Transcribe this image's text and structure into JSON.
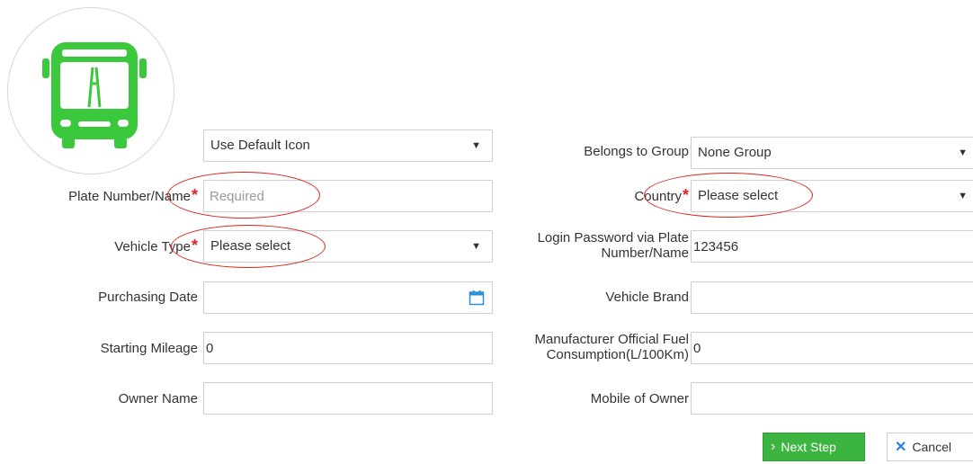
{
  "avatar": {
    "icon": "bus-icon",
    "color": "#3cc83c"
  },
  "icon_select": {
    "value": "Use Default Icon"
  },
  "left": {
    "plate": {
      "label": "Plate Number/Name",
      "required_mark": "*",
      "placeholder": "Required"
    },
    "vehicle_type": {
      "label": "Vehicle Type",
      "required_mark": "*",
      "value": "Please select"
    },
    "purchasing_date": {
      "label": "Purchasing Date",
      "value": ""
    },
    "starting_mileage": {
      "label": "Starting Mileage",
      "value": "0"
    },
    "owner_name": {
      "label": "Owner Name",
      "value": ""
    }
  },
  "right": {
    "group": {
      "label": "Belongs to Group",
      "value": "None Group"
    },
    "country": {
      "label": "Country",
      "required_mark": "*",
      "value": "Please select"
    },
    "login_password": {
      "label_line1": "Login Password via Plate",
      "label_line2": "Number/Name",
      "value": "123456"
    },
    "vehicle_brand": {
      "label": "Vehicle Brand",
      "value": ""
    },
    "fuel": {
      "label_line1": "Manufacturer Official Fuel",
      "label_line2": "Consumption(L/100Km)",
      "value": "0"
    },
    "mobile_owner": {
      "label": "Mobile of Owner",
      "value": ""
    }
  },
  "buttons": {
    "next": "Next Step",
    "cancel": "Cancel"
  },
  "colors": {
    "accent_green": "#3bb53f",
    "required_red": "#e02424",
    "annotation_red": "#d9261c",
    "calendar_blue": "#2b8fd6"
  }
}
